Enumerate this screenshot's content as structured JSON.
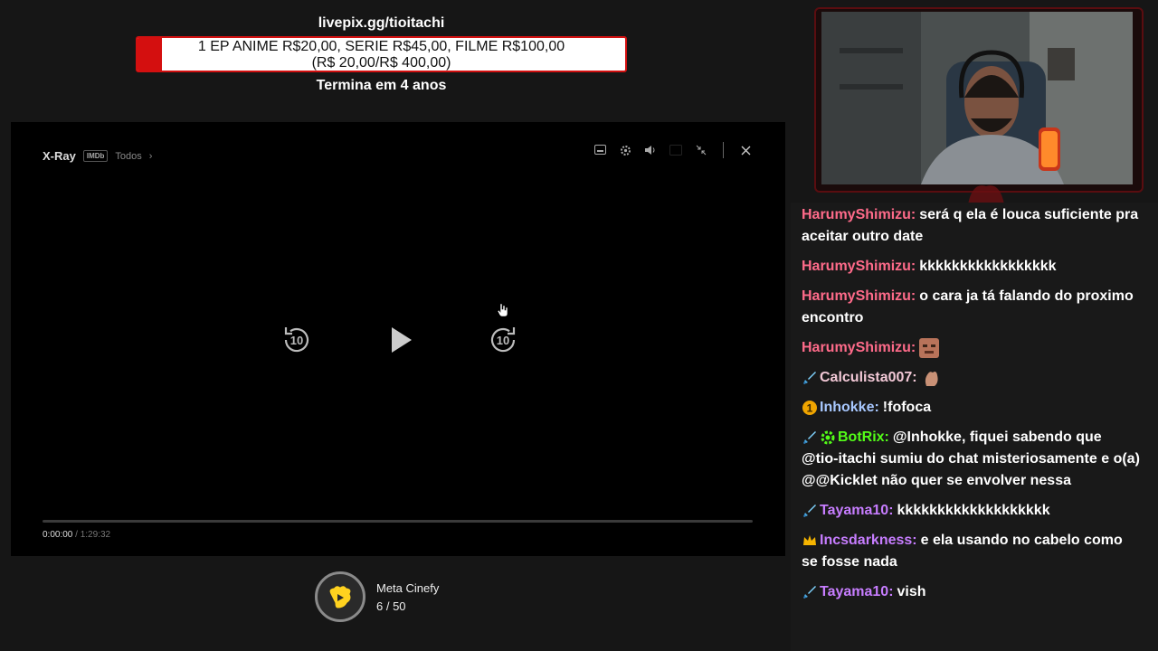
{
  "goal": {
    "url": "livepix.gg/tioitachi",
    "line1": "1 EP ANIME R$20,00, SERIE R$45,00, FILME R$100,00",
    "line2": "(R$ 20,00/R$ 400,00)",
    "progress_fraction": 0.05,
    "ends": "Termina em 4 anos",
    "fill_color": "#d40f0f"
  },
  "player": {
    "xray_label": "X-Ray",
    "imdb_badge": "IMDb",
    "all_link": "Todos",
    "chevron": "›",
    "controls": [
      "subtitles-icon",
      "settings-icon",
      "volume-icon",
      "pip-icon",
      "minimize-icon",
      "close-icon"
    ],
    "rewind_label": "10",
    "forward_label": "10",
    "current_time": "0:00:00",
    "time_sep": "/",
    "total_time": "1:29:32",
    "progress_fraction": 0
  },
  "meta": {
    "name": "Meta Cinefy",
    "count": "6 / 50"
  },
  "chat": {
    "messages": [
      {
        "user": "HarumyShimizu:",
        "color": "#ff6b8a",
        "text": "será q ela é louca suficiente pra aceitar outro date",
        "badge": null,
        "emote": null
      },
      {
        "user": "HarumyShimizu:",
        "color": "#ff6b8a",
        "text": "kkkkkkkkkkkkkkkkk",
        "badge": null,
        "emote": null
      },
      {
        "user": "HarumyShimizu:",
        "color": "#ff6b8a",
        "text": "o cara ja tá falando do proximo encontro",
        "badge": null,
        "emote": null
      },
      {
        "user": "HarumyShimizu:",
        "color": "#ff6b8a",
        "text": "",
        "badge": null,
        "emote": "face-emote"
      },
      {
        "user": "Calculista007:",
        "color": "#f2c8d6",
        "text": "",
        "badge": "sword-icon",
        "emote": "hand-emote"
      },
      {
        "user": "Inhokke:",
        "color": "#a8c8ff",
        "text": "!fofoca",
        "badge": "number-one-icon",
        "emote": null
      },
      {
        "user": "BotRix:",
        "color": "#53fc18",
        "text": "@Inhokke, fiquei sabendo que @tio-itachi sumiu do chat misteriosamente e o(a) @@Kicklet não quer se envolver nessa",
        "badge": "sword-icon",
        "emote": null,
        "bot": true
      },
      {
        "user": "Tayama10:",
        "color": "#c77dff",
        "text": "kkkkkkkkkkkkkkkkkkk",
        "badge": "sword-icon",
        "emote": null
      },
      {
        "user": "Incsdarkness:",
        "color": "#c77dff",
        "text": "e ela usando no cabelo como se fosse nada",
        "badge": "crown-icon",
        "emote": null
      },
      {
        "user": "Tayama10:",
        "color": "#c77dff",
        "text": "vish",
        "badge": "sword-icon",
        "emote": null
      }
    ]
  }
}
